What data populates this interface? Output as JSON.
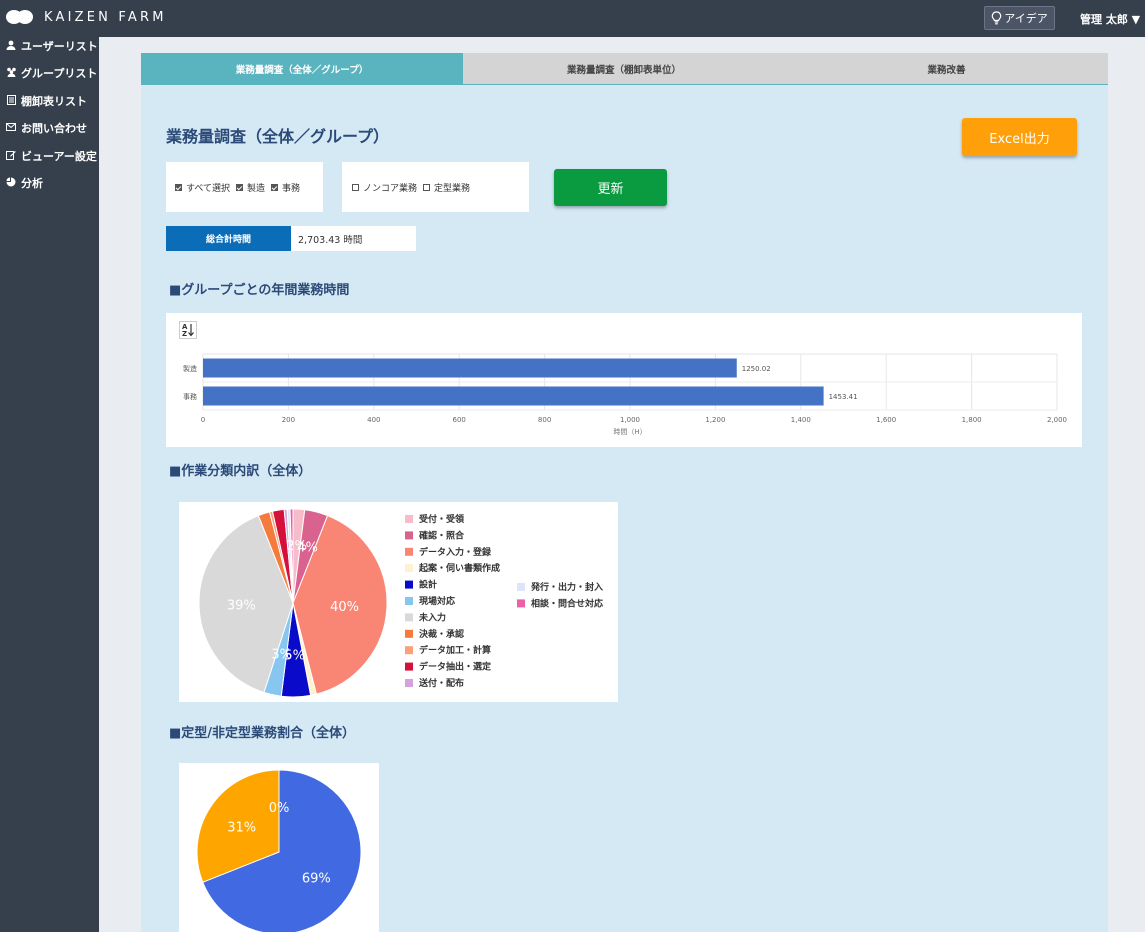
{
  "app": {
    "logo_text": "KAIZEN FARM"
  },
  "header": {
    "idea_button": "アイデア",
    "user_menu": "管理 太郎 ▼"
  },
  "sidebar": {
    "items": [
      {
        "label": "ユーザーリスト",
        "icon": "user-icon"
      },
      {
        "label": "グループリスト",
        "icon": "group-icon"
      },
      {
        "label": "棚卸表リスト",
        "icon": "list-icon"
      },
      {
        "label": "お問い合わせ",
        "icon": "mail-icon"
      },
      {
        "label": "ビューアー設定",
        "icon": "edit-icon"
      },
      {
        "label": "分析",
        "icon": "pie-icon"
      }
    ]
  },
  "tabs": [
    {
      "label": "業務量調査（全体／グループ）",
      "active": true
    },
    {
      "label": "業務量調査（棚卸表単位）",
      "active": false
    },
    {
      "label": "業務改善",
      "active": false
    }
  ],
  "page": {
    "title": "業務量調査（全体／グループ）",
    "excel_button": "Excel出力",
    "update_button": "更新",
    "filters_group": [
      {
        "label": "すべて選択",
        "checked": true
      },
      {
        "label": "製造",
        "checked": true
      },
      {
        "label": "事務",
        "checked": true
      }
    ],
    "filters_type": [
      {
        "label": "ノンコア業務",
        "checked": false
      },
      {
        "label": "定型業務",
        "checked": false
      }
    ],
    "total_label": "総合計時間",
    "total_value": "2,703.43 時間"
  },
  "sections": {
    "bar_title": "■グループごとの年間業務時間",
    "pie1_title": "■作業分類内訳（全体）",
    "pie2_title": "■定型/非定型業務割合（全体）"
  },
  "chart_data": [
    {
      "type": "bar",
      "orientation": "horizontal",
      "categories": [
        "製造",
        "事務"
      ],
      "values": [
        1250.02,
        1453.41
      ],
      "value_labels": [
        "1250.02",
        "1453.41"
      ],
      "xlim": [
        0,
        2000
      ],
      "xticks": [
        "0",
        "200",
        "400",
        "600",
        "800",
        "1,000",
        "1,200",
        "1,400",
        "1,600",
        "1,800",
        "2,000"
      ],
      "xlabel": "時間（H）",
      "color": "#4472c4",
      "grid": true
    },
    {
      "type": "pie",
      "legend_position": "right",
      "slices": [
        {
          "label": "受付・受領",
          "value": 2,
          "color": "#f6bcc9"
        },
        {
          "label": "確認・照合",
          "value": 4,
          "color": "#d9638e"
        },
        {
          "label": "データ入力・登録",
          "value": 40,
          "color": "#f98574"
        },
        {
          "label": "起案・伺い書類作成",
          "value": 1,
          "color": "#fdf1cf"
        },
        {
          "label": "設計",
          "value": 5,
          "color": "#0a0acb"
        },
        {
          "label": "現場対応",
          "value": 3,
          "color": "#86c6f1"
        },
        {
          "label": "未入力",
          "value": 39,
          "color": "#d9d9d9"
        },
        {
          "label": "決裁・承認",
          "value": 2,
          "color": "#f47a3e"
        },
        {
          "label": "データ加工・計算",
          "value": 0.5,
          "color": "#f8a17a"
        },
        {
          "label": "データ抽出・選定",
          "value": 2,
          "color": "#d5103b"
        },
        {
          "label": "送付・配布",
          "value": 0.5,
          "color": "#d5a2dd"
        },
        {
          "label": "発行・出力・封入",
          "value": 0.5,
          "color": "#dee5fb"
        },
        {
          "label": "相談・問合せ対応",
          "value": 0.5,
          "color": "#ec60a8"
        }
      ],
      "visible_labels": [
        "40%",
        "39%",
        "3%",
        "5%",
        "2%",
        "4%"
      ]
    },
    {
      "type": "pie",
      "slices": [
        {
          "label": "",
          "value": 69,
          "color": "#4169e1"
        },
        {
          "label": "",
          "value": 31,
          "color": "#ffa500"
        },
        {
          "label": "",
          "value": 0,
          "color": "#d9d9d9"
        }
      ],
      "visible_labels": [
        "69%",
        "31%",
        "0%"
      ]
    }
  ]
}
